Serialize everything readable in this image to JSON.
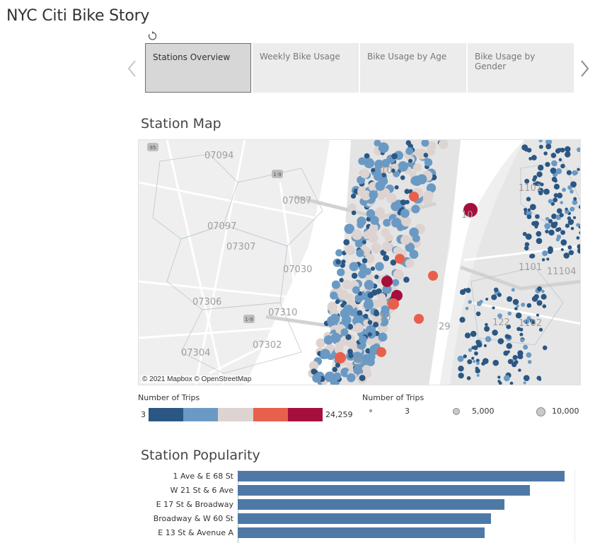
{
  "story": {
    "title": "NYC Citi Bike Story"
  },
  "tabs": [
    {
      "label": "Stations Overview",
      "active": true
    },
    {
      "label": "Weekly Bike Usage",
      "active": false
    },
    {
      "label": "Bike Usage by Age",
      "active": false
    },
    {
      "label": "Bike Usage by Gender",
      "active": false
    }
  ],
  "station_map": {
    "title": "Station Map",
    "attribution": "© 2021 Mapbox  © OpenStreetMap",
    "zip_labels": [
      "07094",
      "07087",
      "07097",
      "07307",
      "07030",
      "07306",
      "07310",
      "07304",
      "07302",
      "1101",
      "1102",
      "1101",
      "11104",
      "122",
      "10",
      "10",
      "10",
      "10",
      "29"
    ],
    "road_badges": [
      "95",
      "1-9",
      "1-9"
    ],
    "color_legend": {
      "title": "Number of Trips",
      "min": "3",
      "max": "24,259",
      "colors": [
        "#2a5783",
        "#6a9ac4",
        "#ddd3d0",
        "#e8604c",
        "#a50f3b"
      ]
    },
    "size_legend": {
      "title": "Number of Trips",
      "values": [
        "3",
        "5,000",
        "10,000"
      ]
    }
  },
  "station_popularity": {
    "title": "Station Popularity",
    "chart_data": {
      "type": "bar",
      "orientation": "horizontal",
      "categories": [
        "1 Ave & E 68 St",
        "W 21 St & 6 Ave",
        "E 17 St & Broadway",
        "Broadway & W 60 St",
        "E 13 St & Avenue A"
      ],
      "values": [
        24259,
        21700,
        19800,
        18800,
        18300
      ],
      "color": "#4e79a7"
    }
  }
}
